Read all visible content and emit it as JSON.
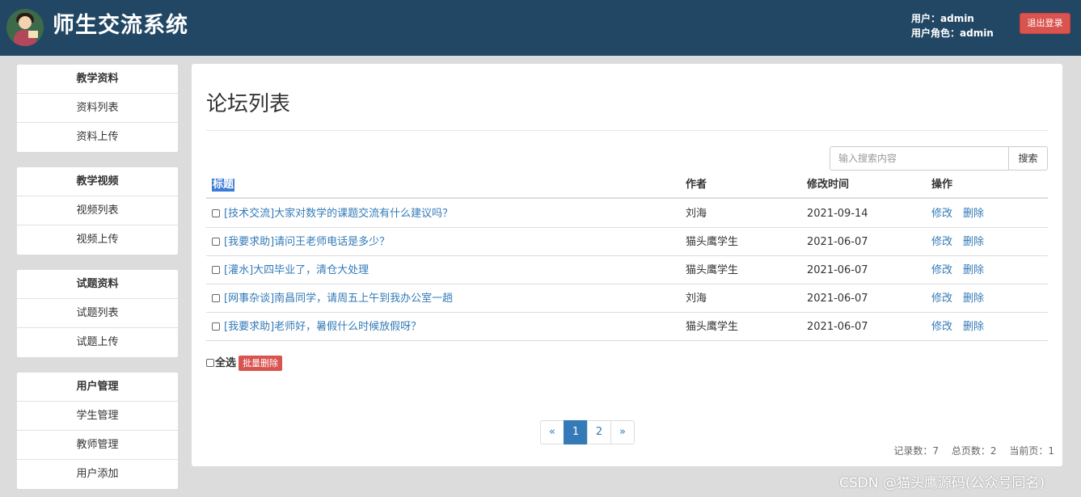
{
  "header": {
    "app_title": "师生交流系统",
    "user_line": "用户：admin",
    "role_line": "用户角色：admin",
    "logout_label": "退出登录"
  },
  "sidebar": {
    "groups": [
      {
        "title": "教学资料",
        "items": [
          "资料列表",
          "资料上传"
        ]
      },
      {
        "title": "教学视频",
        "items": [
          "视频列表",
          "视频上传"
        ]
      },
      {
        "title": "试题资料",
        "items": [
          "试题列表",
          "试题上传"
        ]
      },
      {
        "title": "用户管理",
        "items": [
          "学生管理",
          "教师管理",
          "用户添加"
        ]
      }
    ]
  },
  "main": {
    "page_title": "论坛列表",
    "search": {
      "placeholder": "输入搜索内容",
      "value": "",
      "button_label": "搜索"
    },
    "table": {
      "headers": {
        "title": "标题",
        "author": "作者",
        "time": "修改时间",
        "ops": "操作"
      },
      "rows": [
        {
          "title": "[技术交流]大家对数学的课题交流有什么建议吗？",
          "author": "刘海",
          "time": "2021-09-14"
        },
        {
          "title": "[我要求助]请问王老师电话是多少？",
          "author": "猫头鹰学生",
          "time": "2021-06-07"
        },
        {
          "title": "[灌水]大四毕业了，清仓大处理",
          "author": "猫头鹰学生",
          "time": "2021-06-07"
        },
        {
          "title": "[网事杂谈]南昌同学，请周五上午到我办公室一趟",
          "author": "刘海",
          "time": "2021-06-07"
        },
        {
          "title": "[我要求助]老师好，暑假什么时候放假呀？",
          "author": "猫头鹰学生",
          "time": "2021-06-07"
        }
      ],
      "edit_label": "修改",
      "delete_label": "删除"
    },
    "select_all_label": "全选",
    "batch_delete_label": "批量删除",
    "pagination": {
      "prev": "«",
      "pages": [
        "1",
        "2"
      ],
      "current": "1",
      "next": "»"
    },
    "stats": {
      "records": "记录数：7",
      "total_pages": "总页数：2",
      "current_page": "当前页：1"
    }
  },
  "watermark": "CSDN @猫头鹰源码(公众号同名)",
  "colors": {
    "header_bg": "#224764",
    "accent": "#337ab7",
    "danger": "#d9534f",
    "page_bg": "#dcdcdc"
  }
}
